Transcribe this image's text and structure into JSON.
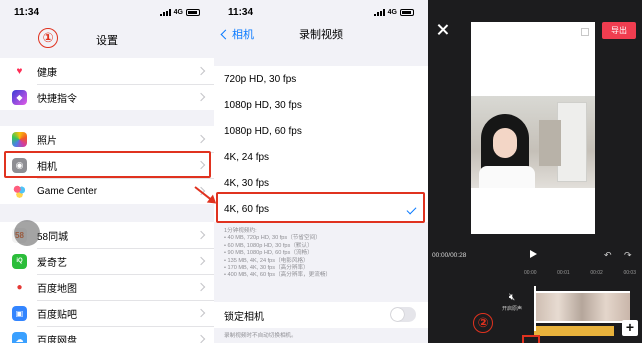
{
  "settings": {
    "status_time": "11:34",
    "network": "4G",
    "title": "设置",
    "step_badge": "①",
    "items": [
      {
        "label": "健康",
        "icon": "heart-icon",
        "color": "#ffffff"
      },
      {
        "label": "快捷指令",
        "icon": "shortcuts-icon",
        "color": "#3a3cd6"
      },
      {
        "label": "照片",
        "icon": "photos-icon",
        "color": "#ffffff"
      },
      {
        "label": "相机",
        "icon": "camera-icon",
        "color": "#8e8e93"
      },
      {
        "label": "Game Center",
        "icon": "game-center-icon",
        "color": "#ffffff"
      },
      {
        "label": "58同城",
        "icon": "58-app-icon",
        "color": "#f3f3f3"
      },
      {
        "label": "爱奇艺",
        "icon": "iqiyi-icon",
        "color": "#2bbd3a"
      },
      {
        "label": "百度地图",
        "icon": "baidu-map-icon",
        "color": "#ffffff"
      },
      {
        "label": "百度贴吧",
        "icon": "baidu-tieba-icon",
        "color": "#3385ff"
      },
      {
        "label": "百度网盘",
        "icon": "baidu-netdisk-icon",
        "color": "#3aa0ff"
      }
    ]
  },
  "record_video": {
    "status_time": "11:34",
    "network": "4G",
    "back_label": "相机",
    "title": "录制视频",
    "options": [
      {
        "label": "720p HD, 30 fps",
        "selected": false
      },
      {
        "label": "1080p HD, 30 fps",
        "selected": false
      },
      {
        "label": "1080p HD, 60 fps",
        "selected": false
      },
      {
        "label": "4K, 24 fps",
        "selected": false
      },
      {
        "label": "4K, 30 fps",
        "selected": false
      },
      {
        "label": "4K, 60 fps",
        "selected": true
      }
    ],
    "notes": [
      "1分钟视频约:",
      "• 40 MB, 720p HD, 30 fps（节省空间）",
      "• 60 MB, 1080p HD, 30 fps（默认）",
      "• 90 MB, 1080p HD, 60 fps（流畅）",
      "• 135 MB, 4K, 24 fps（电影风格）",
      "• 170 MB, 4K, 30 fps（高分辨率）",
      "• 400 MB, 4K, 60 fps（高分辨率，更流畅）"
    ],
    "lock_camera_label": "锁定相机",
    "lock_camera_on": false,
    "lock_camera_note": "录制视频时不自动切换相机。"
  },
  "editor": {
    "export_label": "导出",
    "timecode": "00:00/00:28",
    "ruler_ticks": [
      "00:00",
      "00:01",
      "00:02",
      "00:03"
    ],
    "mute_label": "开启原声",
    "step_badge": "②",
    "add_label": "+",
    "accent_color": "#f03d50"
  }
}
